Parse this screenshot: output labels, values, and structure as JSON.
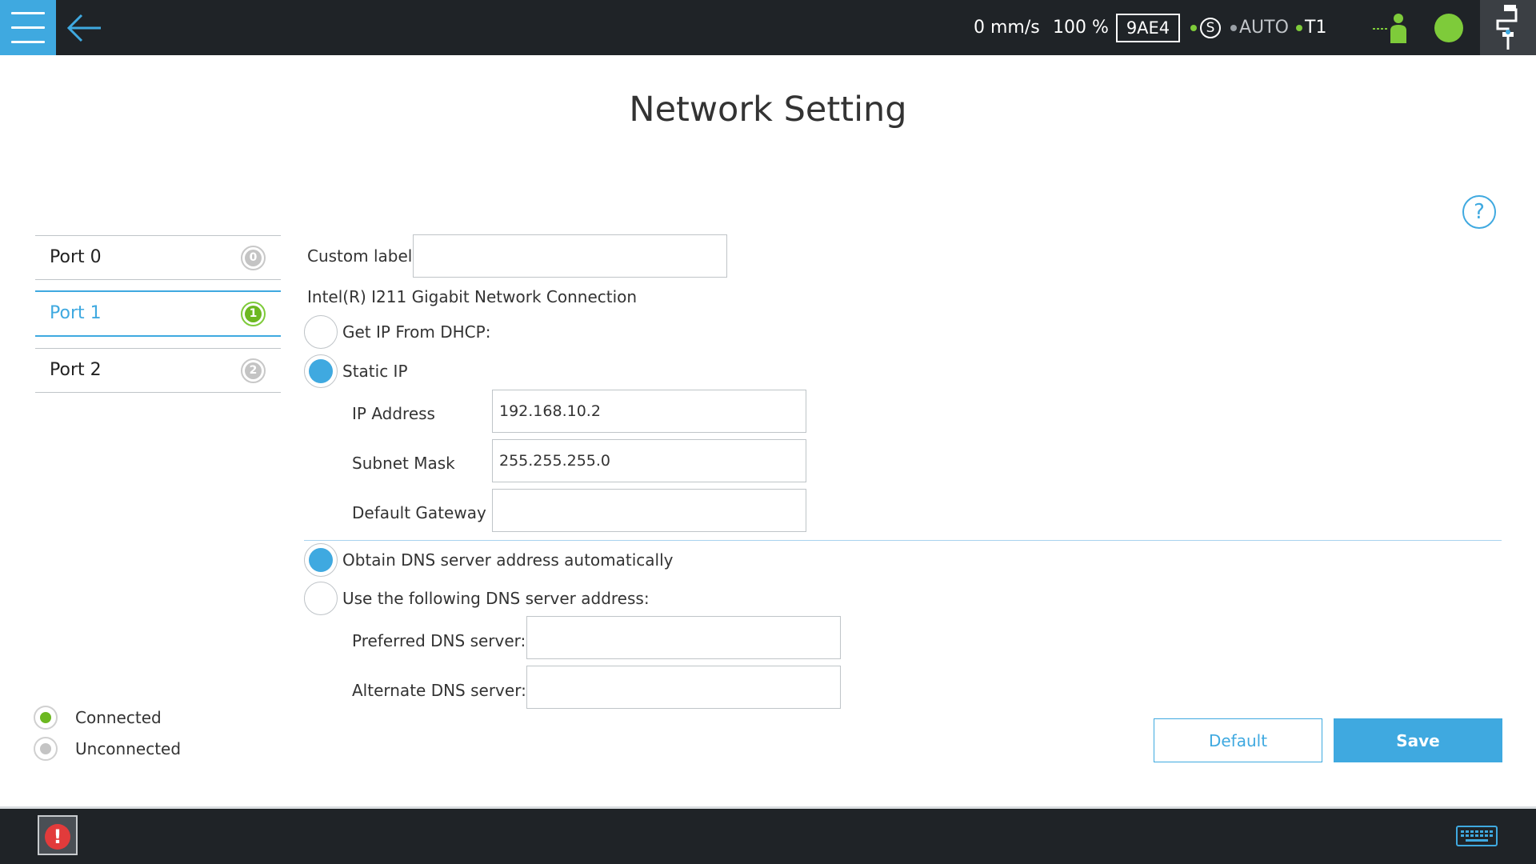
{
  "topbar": {
    "speed": "0 mm/s",
    "override": "100 %",
    "code": "9AE4",
    "safety_symbol": "S",
    "mode": "AUTO",
    "tool": "T1",
    "icons": [
      "menu-icon",
      "back-arrow-icon",
      "robot-person-icon",
      "status-light-icon",
      "robot-arm-icon"
    ]
  },
  "title": "Network Setting",
  "help": "?",
  "ports": [
    {
      "label": "Port 0",
      "badge": "0",
      "connected": false
    },
    {
      "label": "Port 1",
      "badge": "1",
      "connected": true
    },
    {
      "label": "Port 2",
      "badge": "2",
      "connected": false
    }
  ],
  "legend": {
    "connected": "Connected",
    "unconnected": "Unconnected"
  },
  "form": {
    "custom_label": "Custom label",
    "custom_label_value": "",
    "adapter": "Intel(R) I211 Gigabit Network Connection",
    "dhcp": "Get IP From DHCP:",
    "static_ip": "Static IP",
    "ip_label": "IP Address",
    "ip_value": "192.168.10.2",
    "subnet_label": "Subnet Mask",
    "subnet_value": "255.255.255.0",
    "gateway_label": "Default Gateway",
    "gateway_value": "",
    "dns_auto": "Obtain DNS server address automatically",
    "dns_manual": "Use the following DNS server address:",
    "preferred_dns_label": "Preferred DNS server:",
    "preferred_dns_value": "",
    "alternate_dns_label": "Alternate DNS server:",
    "alternate_dns_value": ""
  },
  "buttons": {
    "default": "Default",
    "save": "Save"
  },
  "colors": {
    "accent": "#3fa9e0",
    "connected": "#6cb820",
    "unconnected": "#c4c4c4",
    "bar": "#1f2327",
    "alert": "#e23b3b"
  }
}
